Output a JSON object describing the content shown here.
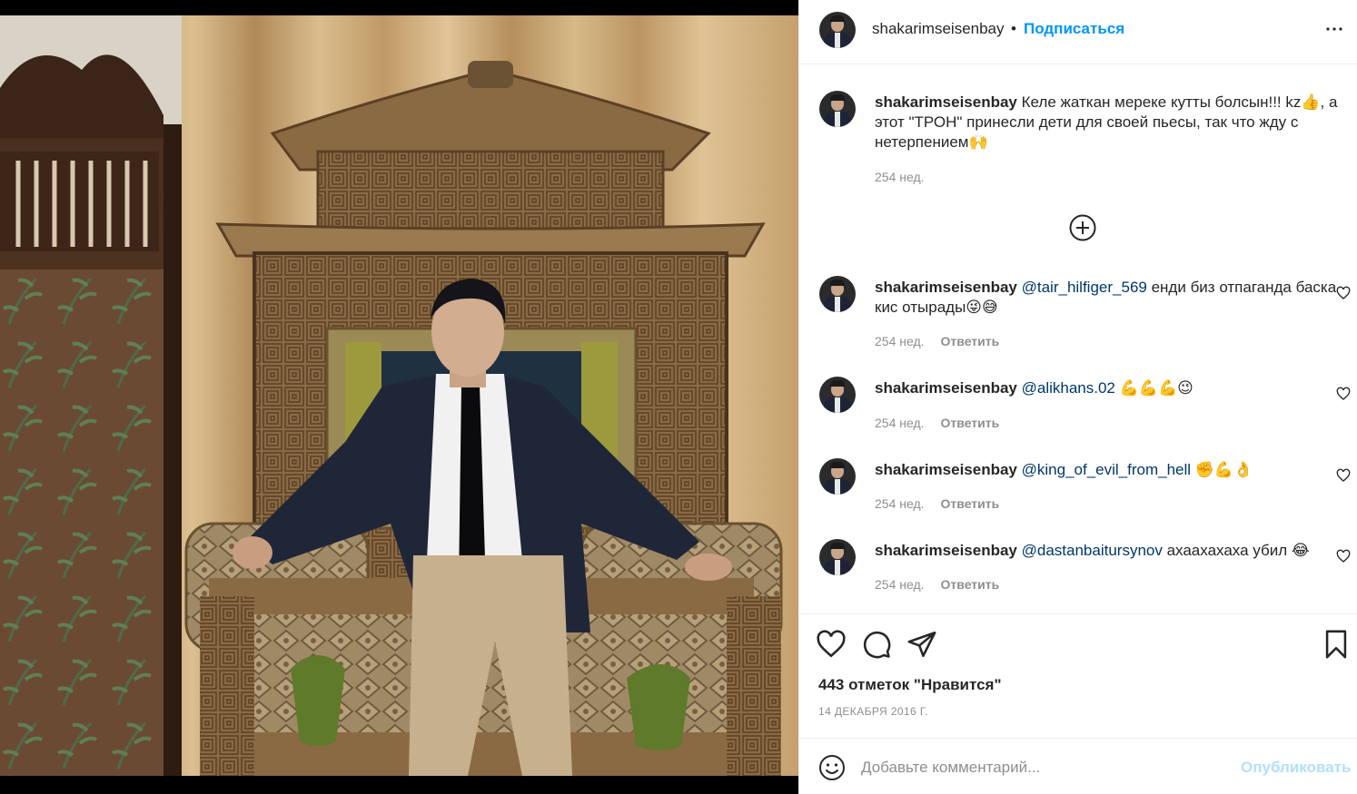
{
  "post": {
    "author": "shakarimseisenbay",
    "separator": "•",
    "follow_label": "Подписаться",
    "likes": "443 отметок \"Нравится\"",
    "date": "14 ДЕКАБРЯ 2016 Г."
  },
  "caption": {
    "username": "shakarimseisenbay",
    "text": "Келе жаткан мереке кутты болсын!!! kz👍, а этот \"ТРОН\" принесли дети для своей пьесы, так что жду с нетерпением🙌",
    "time": "254 нед."
  },
  "comments": [
    {
      "username": "shakarimseisenbay",
      "mention": "@tair_hilfiger_569",
      "text": " енди биз отпаганда баска кис отырады😜😅",
      "time": "254 нед.",
      "reply": "Ответить"
    },
    {
      "username": "shakarimseisenbay",
      "mention": "@alikhans.02",
      "text": " 💪💪💪😉",
      "time": "254 нед.",
      "reply": "Ответить"
    },
    {
      "username": "shakarimseisenbay",
      "mention": "@king_of_evil_from_hell",
      "text": " ✊💪👌",
      "time": "254 нед.",
      "reply": "Ответить"
    },
    {
      "username": "shakarimseisenbay",
      "mention": "@dastanbaitursynov",
      "text": " ахаахахаха убил 😂",
      "time": "254 нед.",
      "reply": "Ответить"
    }
  ],
  "composer": {
    "placeholder": "Добавьте комментарий...",
    "publish_label": "Опубликовать"
  },
  "icons": {
    "more": "more-options-icon",
    "load_more": "plus-circle-icon",
    "like": "heart-icon",
    "comment": "comment-icon",
    "share": "paper-plane-icon",
    "save": "bookmark-icon",
    "emoji": "emoji-smile-icon"
  },
  "colors": {
    "accent": "#0095f6",
    "mention": "#00376b",
    "muted": "#8e8e8e",
    "publish_disabled": "#b2dffc"
  }
}
